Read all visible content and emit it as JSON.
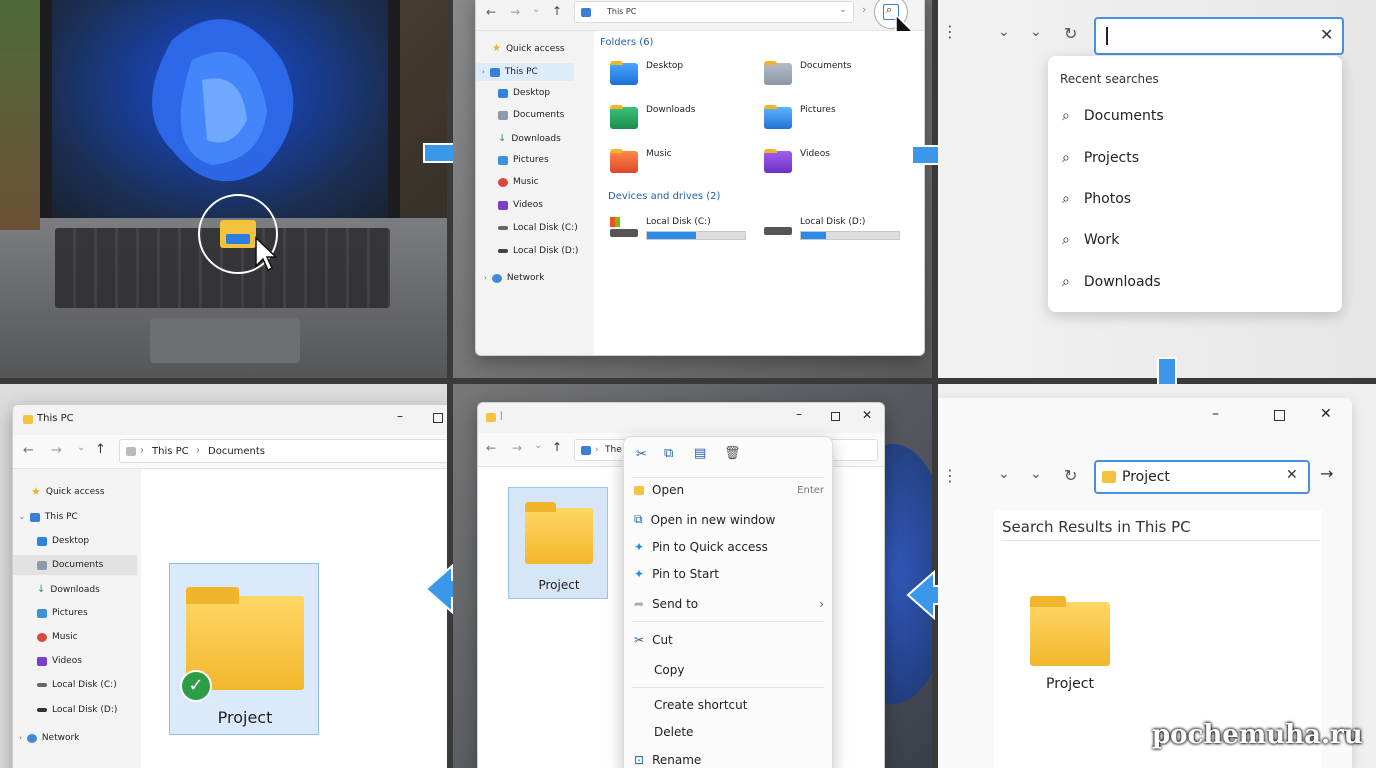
{
  "panel1": {
    "app_icon": "file-explorer-icon"
  },
  "panel2": {
    "address": "This PC",
    "folders_header": "Folders (6)",
    "folders": [
      "Desktop",
      "Documents",
      "Downloads",
      "Pictures",
      "Music",
      "Videos"
    ],
    "drives_header": "Devices and drives (2)",
    "drives": [
      {
        "label": "Local Disk (C:)",
        "used": 0.5
      },
      {
        "label": "Local Disk (D:)",
        "used": 0.25
      }
    ],
    "nav": [
      "Quick access",
      "This PC",
      "Desktop",
      "Documents",
      "Downloads",
      "Pictures",
      "Music",
      "Videos",
      "Local Disk (C:)",
      "Local Disk (D:)",
      "Network"
    ]
  },
  "panel3": {
    "recent_header": "Recent searches",
    "recent": [
      "Documents",
      "Projects",
      "Photos",
      "Work",
      "Downloads"
    ]
  },
  "panel4": {
    "title": "This PC",
    "crumbs": [
      "This PC",
      "Documents"
    ],
    "nav": [
      "Quick access",
      "This PC",
      "Desktop",
      "Documents",
      "Downloads",
      "Pictures",
      "Music",
      "Videos",
      "Local Disk (C:)",
      "Local Disk (D:)",
      "Network"
    ],
    "folder_label": "Project"
  },
  "panel5": {
    "address": "The",
    "folder_label": "Project",
    "menu": {
      "open": "Open",
      "open_shortcut": "Enter",
      "open_new_window": "Open in new window",
      "pin_quick": "Pin to Quick access",
      "pin_start": "Pin to Start",
      "send_to": "Send to",
      "cut": "Cut",
      "copy": "Copy",
      "create_shortcut": "Create shortcut",
      "delete": "Delete",
      "rename": "Rename"
    }
  },
  "panel6": {
    "search_value": "Project",
    "results_header": "Search Results in This PC",
    "folder_label": "Project"
  },
  "watermark": "pochemuha.ru",
  "colors": {
    "accent": "#2b8ae6",
    "arrow": "#3a97ea",
    "folder": "#f7c443"
  }
}
